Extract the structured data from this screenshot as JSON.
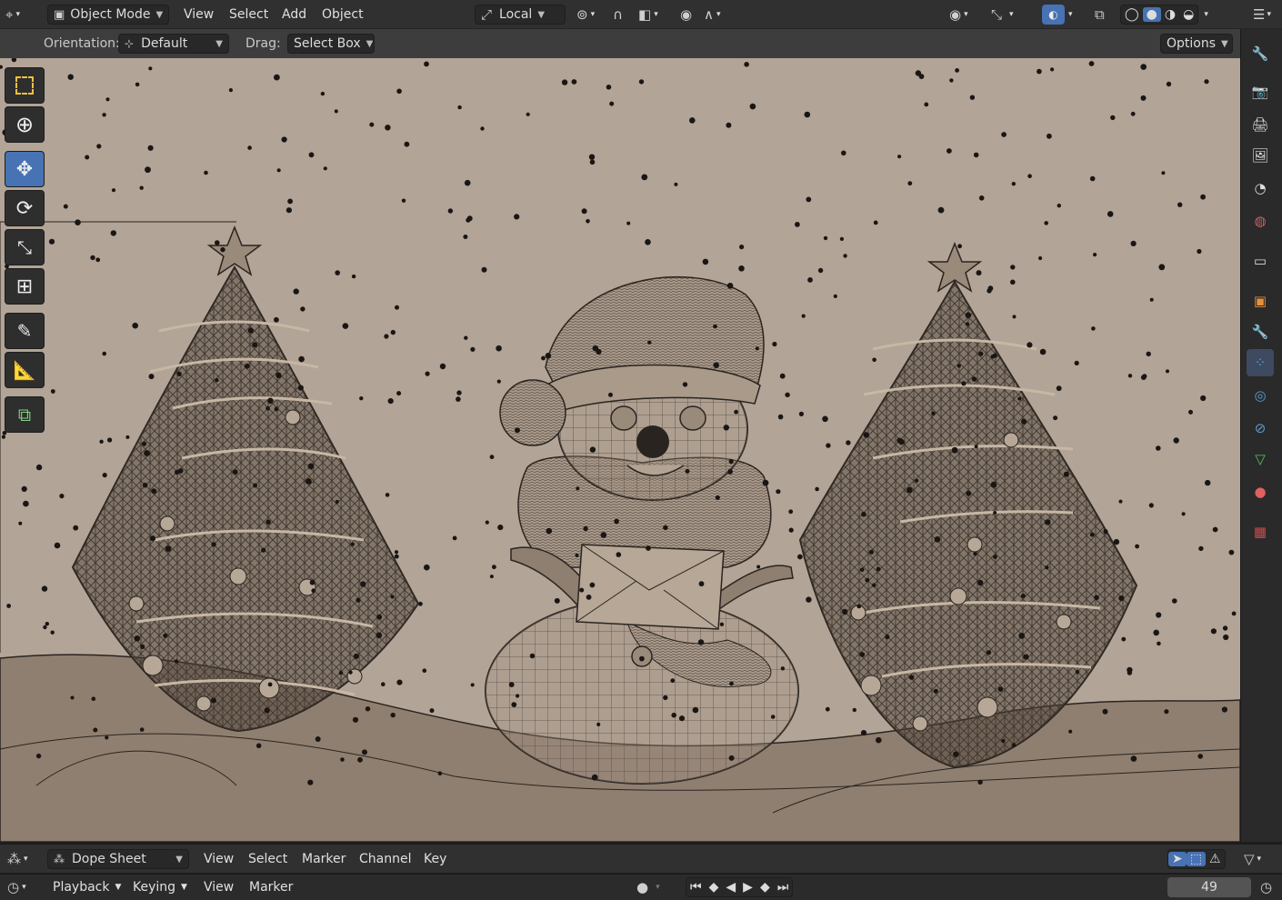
{
  "top_header": {
    "mode_label": "Object Mode",
    "menus": [
      "View",
      "Select",
      "Add",
      "Object"
    ],
    "transform_pivot_label": "Local"
  },
  "tool_header": {
    "orientation_label": "Orientation:",
    "orientation_value": "Default",
    "drag_label": "Drag:",
    "drag_value": "Select Box",
    "options_label": "Options"
  },
  "toolbar_tools": [
    {
      "name": "select-box-tool",
      "icon": "select-box-icon",
      "active": false
    },
    {
      "name": "cursor-tool",
      "icon": "cursor-icon",
      "active": false
    },
    {
      "name": "move-tool",
      "icon": "move-icon",
      "active": true
    },
    {
      "name": "rotate-tool",
      "icon": "rotate-icon",
      "active": false
    },
    {
      "name": "scale-tool",
      "icon": "scale-icon",
      "active": false
    },
    {
      "name": "transform-tool",
      "icon": "transform-icon",
      "active": false
    },
    {
      "name": "annotate-tool",
      "icon": "annotate-icon",
      "active": false
    },
    {
      "name": "measure-tool",
      "icon": "measure-icon",
      "active": false
    },
    {
      "name": "add-cube-tool",
      "icon": "add-cube-icon",
      "active": false
    }
  ],
  "properties_tabs": [
    "tool-icon",
    "render-icon",
    "output-icon",
    "view-layer-icon",
    "scene-icon",
    "world-icon",
    "collection-icon",
    "object-icon",
    "modifier-icon",
    "particles-icon",
    "physics-icon",
    "constraints-icon",
    "data-icon",
    "material-icon",
    "texture-icon"
  ],
  "dope_sheet": {
    "editor_label": "Dope Sheet",
    "menus": [
      "View",
      "Select",
      "Marker",
      "Channel",
      "Key"
    ]
  },
  "timeline": {
    "menus": [
      "Playback",
      "Keying",
      "View",
      "Marker"
    ],
    "current_frame": "49"
  },
  "colors": {
    "accent": "#4772b3",
    "viewport_bg": "#b2a496",
    "wire": "#2a2420"
  }
}
